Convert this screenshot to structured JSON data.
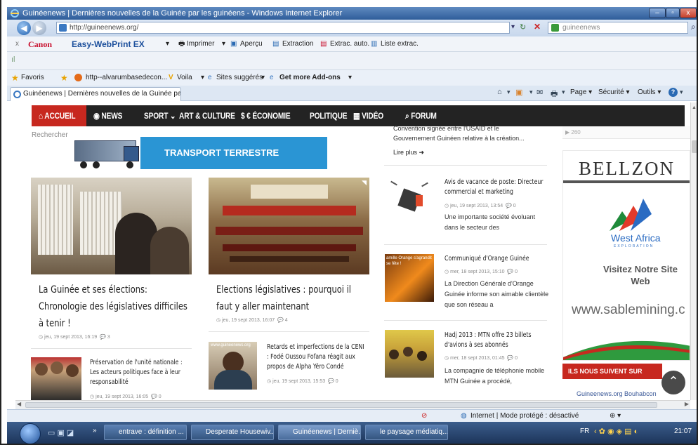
{
  "window": {
    "title": "Guinéenews | Dernières nouvelles de la Guinée par les guinéens - Windows Internet Explorer",
    "controls": [
      "–",
      "▫",
      "x"
    ]
  },
  "addressbar": {
    "url": "http://guineenews.org/",
    "search_value": "guineenews"
  },
  "canon_toolbar": {
    "close": "x",
    "brand": "Canon",
    "product": "Easy-WebPrint EX",
    "imprimer": "Imprimer",
    "apercu": "Aperçu",
    "extraction": "Extraction",
    "extrac_auto": "Extrac. auto.",
    "liste": "Liste extrac."
  },
  "favbar": {
    "favoris": "Favoris",
    "link1": "http--alvarumbasedecon...",
    "link2": "Voila",
    "link3": "Sites suggérés",
    "link4": "Get more Add-ons"
  },
  "tab": {
    "title": "Guinéenews | Dernières nouvelles de la Guinée pa...",
    "cmd_page": "Page",
    "cmd_securite": "Sécurité",
    "cmd_outils": "Outils"
  },
  "site_nav": {
    "items": [
      "ACCUEIL",
      "NEWS",
      "SPORT",
      "ART & CULTURE",
      "$ € ÉCONOMIE",
      "POLITIQUE",
      "VIDÉO",
      "FORUM"
    ]
  },
  "search": {
    "label": "Rechercher"
  },
  "banner": {
    "text": "TRANSPORT TERRESTRE"
  },
  "articles": {
    "a1": {
      "title": "La Guinée et ses élections: Chronologie des législatives difficiles à tenir !",
      "meta": "jeu, 19 sept 2013, 16:19",
      "comments": "3"
    },
    "a2": {
      "title": "Elections législatives : pourquoi il faut y aller maintenant",
      "meta": "jeu, 19 sept 2013, 16:07",
      "comments": "4"
    },
    "a3": {
      "title": "Préservation de l'unité nationale : Les acteurs politiques face à leur responsabilité",
      "meta": "jeu, 19 sept 2013, 16:05",
      "comments": "0"
    },
    "a4": {
      "title": "Retards et imperfections de la CENI : Fodé Oussou Fofana réagit aux propos de Alpha Yéro Condé",
      "meta": "jeu, 19 sept 2013, 15:53",
      "comments": "0",
      "photo_caption": "www.guineenews.org"
    }
  },
  "sidebar_list": {
    "top_excerpt": "Convention signée entre l'USAID et le Gouvernement Guinéen relative à la création...",
    "read_more": "Lire plus",
    "items": [
      {
        "title": "Avis de vacance de poste: Directeur commercial et marketing",
        "meta": "jeu, 19 sept 2013, 13:54",
        "comments": "0",
        "excerpt": "Une importante société évoluant dans le secteur des"
      },
      {
        "title": "Communiqué d'Orange Guinée",
        "meta": "mer, 18 sept 2013, 15:10",
        "comments": "0",
        "excerpt": "La Direction Générale d'Orange Guinée informe son aimable clientèle que son réseau a",
        "photo_caption": "amille Orange s'agrandit se fête !"
      },
      {
        "title": "Hadj 2013 : MTN offre 23 billets d'avions à ses abonnés",
        "meta": "mer, 18 sept 2013, 01:45",
        "comments": "0",
        "excerpt": "La compagnie de téléphonie mobile MTN Guinée a procédé,"
      }
    ]
  },
  "ad": {
    "count": "260",
    "brand": "BELLZON",
    "company": "West Africa",
    "company_sub": "EXPLORATION",
    "visit": "Visitez Notre Site Web",
    "url": "www.sablemining.c",
    "facebook": "ILS NOUS SUIVENT SUR FACEBOOK",
    "fb_page": "Guineenews.org Bouhabcon"
  },
  "statusbar": {
    "text": "Internet | Mode protégé : désactivé",
    "zoom": "⊕"
  },
  "taskbar": {
    "items": [
      "entrave : définition ...",
      "Desperate Housewiv...",
      "Guinéenews | Derniè...",
      "le paysage médiatiq..."
    ],
    "lang": "FR",
    "time": "21:07"
  },
  "colors": {
    "accent_red": "#c7281f",
    "nav_dark": "#232323",
    "banner_blue": "#2a95d4"
  }
}
